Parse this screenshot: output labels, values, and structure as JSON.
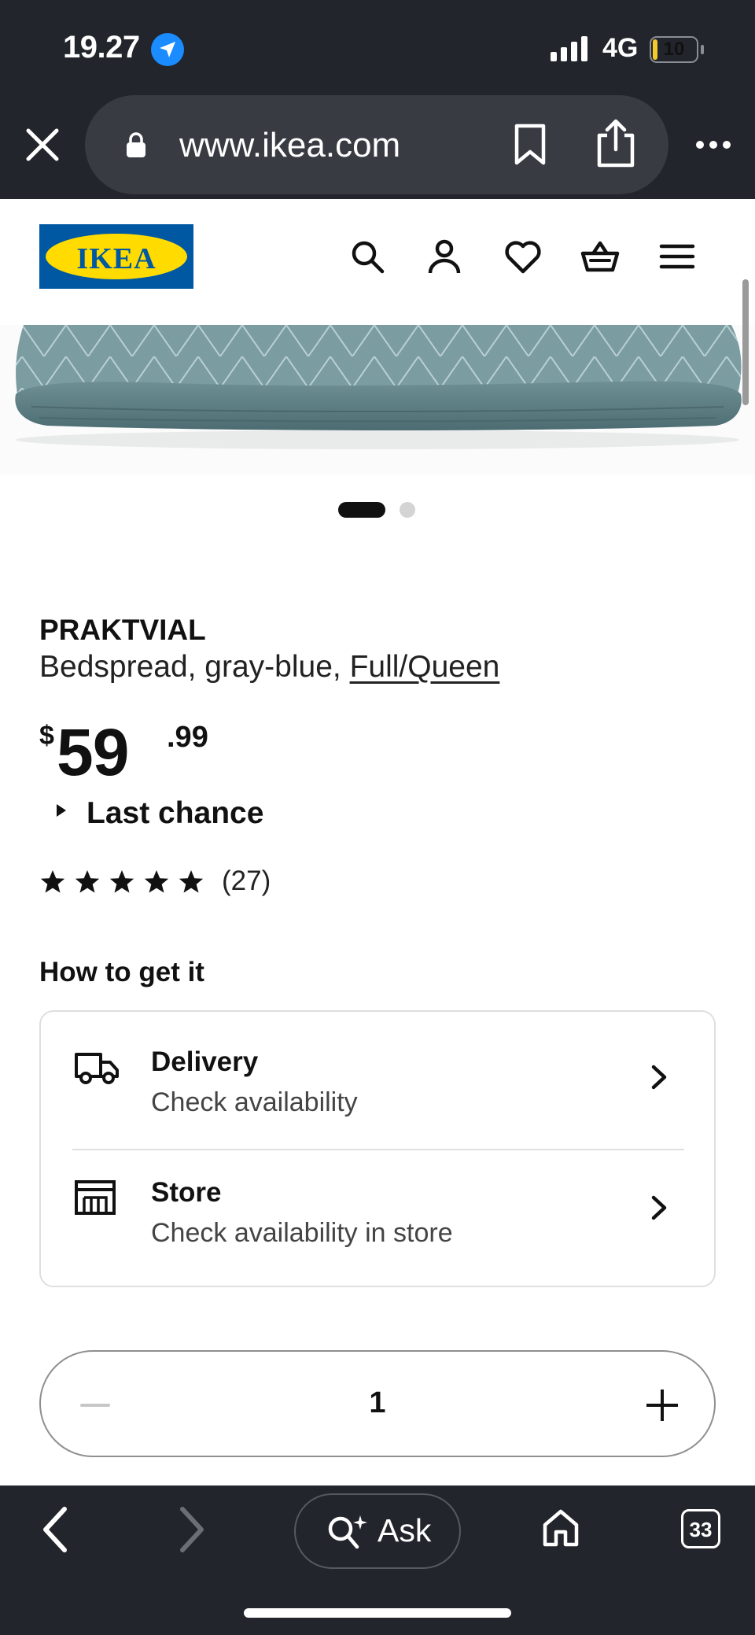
{
  "status_bar": {
    "time": "19.27",
    "network": "4G",
    "battery": "10",
    "battery_level": 0.1
  },
  "browser": {
    "url": "www.ikea.com"
  },
  "site": {
    "logo_text": "IKEA",
    "logo_colors": {
      "blue": "#0058a3",
      "yellow": "#ffdb00"
    }
  },
  "carousel": {
    "current": 1,
    "total": 2
  },
  "product": {
    "name": "PRAKTVIAL",
    "description": "Bedspread, gray-blue, ",
    "size_link": "Full/Queen",
    "price_currency": "$",
    "price_whole": "59",
    "price_cents": ".99",
    "tag": "Last chance",
    "rating": 5,
    "review_count": "(27)"
  },
  "fulfilment": {
    "heading": "How to get it",
    "delivery": {
      "title": "Delivery",
      "subtitle": "Check availability"
    },
    "store": {
      "title": "Store",
      "subtitle": "Check availability in store"
    }
  },
  "quantity": {
    "value": "1"
  },
  "bottom_bar": {
    "ask_label": "Ask",
    "tab_count": "33"
  },
  "icons": [
    "location-arrow-icon",
    "signal-icon",
    "battery-icon",
    "close-icon",
    "lock-icon",
    "bookmark-icon",
    "share-icon",
    "more-icon",
    "search-icon",
    "account-icon",
    "heart-icon",
    "basket-icon",
    "menu-icon",
    "star-icon",
    "truck-icon",
    "store-icon",
    "chevron-right-icon",
    "back-icon",
    "forward-icon",
    "ask-ai-icon",
    "home-icon",
    "tabs-icon"
  ]
}
